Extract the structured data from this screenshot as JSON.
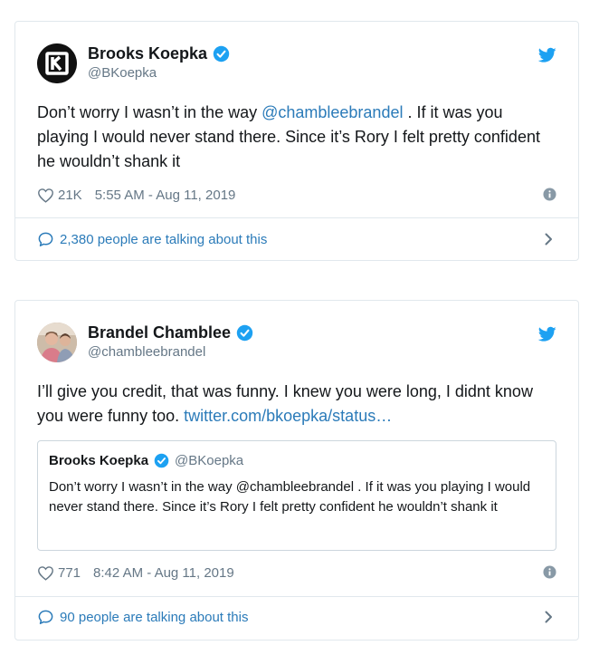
{
  "tweets": [
    {
      "display_name": "Brooks Koepka",
      "screen_name": "@BKoepka",
      "text_before": "Don’t worry I wasn’t in the way ",
      "mention": "@chambleebrandel",
      "text_after": " . If it was you playing I would never stand there. Since it’s Rory I felt pretty confident he wouldn’t shank it",
      "likes": "21K",
      "timestamp": "5:55 AM - Aug 11, 2019",
      "talking": "2,380 people are talking about this",
      "avatar_icon": "brand-logo-icon"
    },
    {
      "display_name": "Brandel Chamblee",
      "screen_name": "@chambleebrandel",
      "text": "I’ll give you credit, that was funny. I knew you were long, I didnt know you were funny too. ",
      "link": "twitter.com/bkoepka/status…",
      "likes": "771",
      "timestamp": "8:42 AM - Aug 11, 2019",
      "talking": "90 people are talking about this",
      "quoted": {
        "display_name": "Brooks Koepka",
        "screen_name": "@BKoepka",
        "text": "Don’t worry I wasn’t in the way @chambleebrandel . If it was you playing I would never stand there. Since it’s Rory I felt pretty confident he wouldn’t shank it"
      }
    }
  ],
  "colors": {
    "link": "#2b7bb9",
    "verified": "#1da1f2",
    "twitter_bird": "#1da1f2",
    "muted": "#657786",
    "border": "#e1e8ed"
  },
  "icons": [
    "verified-icon",
    "twitter-bird-icon",
    "heart-icon",
    "info-icon",
    "speech-bubble-icon",
    "chevron-right-icon"
  ]
}
